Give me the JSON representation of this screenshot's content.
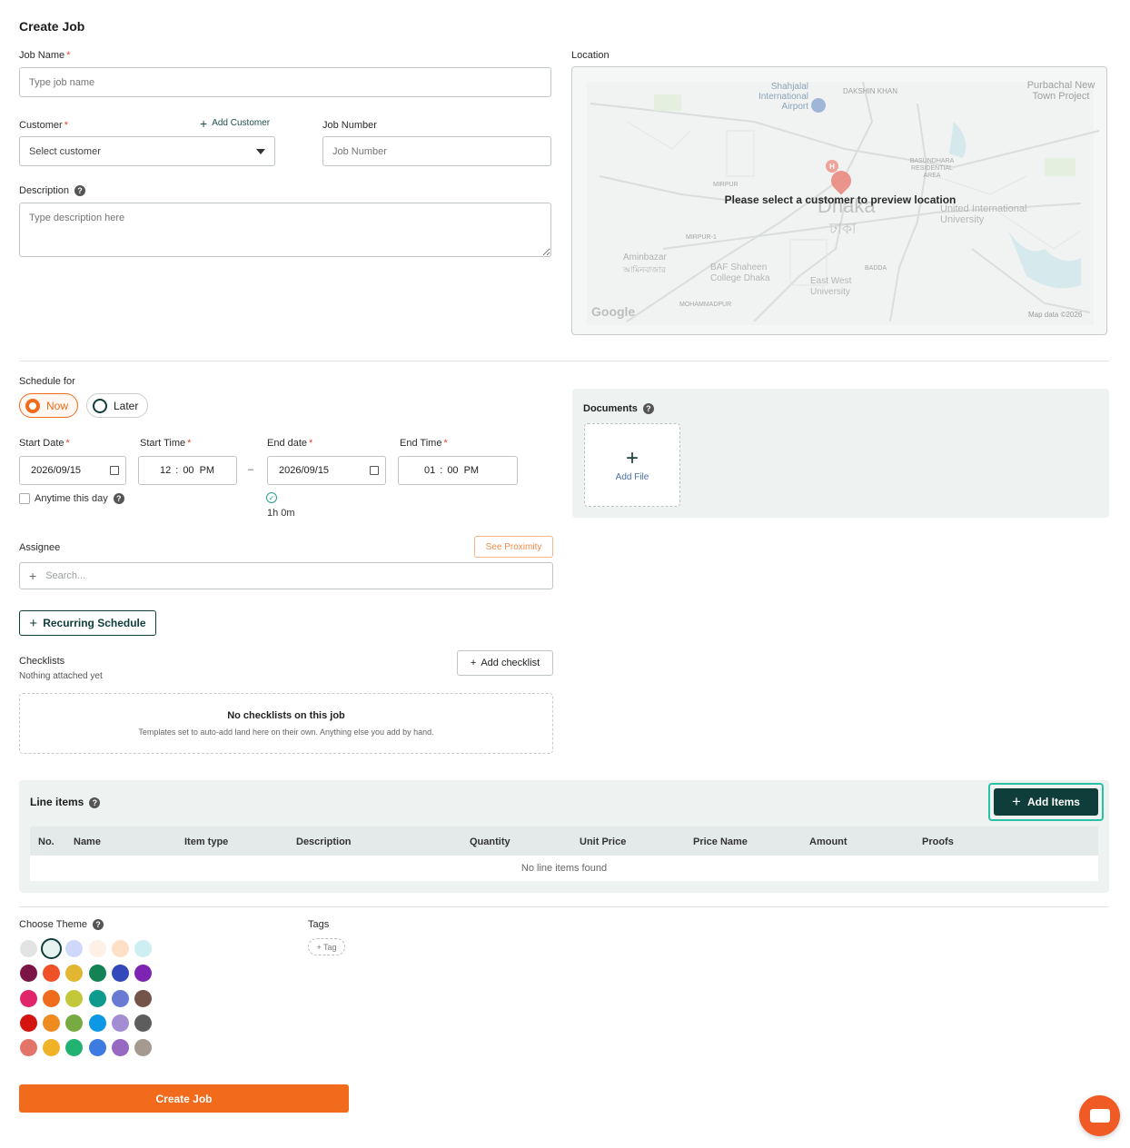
{
  "page_title": "Create Job",
  "job_name": {
    "label": "Job Name",
    "placeholder": "Type job name"
  },
  "customer": {
    "label": "Customer",
    "add_label": "Add Customer",
    "value": "Select customer"
  },
  "job_number": {
    "label": "Job Number",
    "placeholder": "Job Number"
  },
  "description": {
    "label": "Description",
    "placeholder": "Type description here"
  },
  "location": {
    "label": "Location",
    "overlay": "Please select a customer to preview location",
    "map_credit": "Map data ©2026",
    "google": "Google",
    "places": [
      "Shahjalal International Airport",
      "DAKSHIN KHAN",
      "Purbachal New Town Project",
      "BASUNDHARA RESIDENTIAL AREA",
      "MIRPUR",
      "Dhaka",
      "ঢাকা",
      "United International University",
      "MIRPUR-1",
      "Aminbazar",
      "আমিনবাজার",
      "BAF Shaheen College Dhaka",
      "BADDA",
      "East West University",
      "MOHAMMADPUR"
    ]
  },
  "schedule": {
    "label": "Schedule for",
    "now": "Now",
    "later": "Later"
  },
  "start_date": {
    "label": "Start Date",
    "value": "2026/09/15"
  },
  "start_time": {
    "label": "Start Time",
    "hour": "12",
    "minute": "00",
    "ampm": "PM"
  },
  "end_date": {
    "label": "End date",
    "value": "2026/09/15"
  },
  "end_time": {
    "label": "End Time",
    "hour": "01",
    "minute": "00",
    "ampm": "PM"
  },
  "time_sep": ":",
  "range_sep": "–",
  "anytime_label": "Anytime this day",
  "duration": "1h 0m",
  "documents": {
    "label": "Documents",
    "add_file": "Add File"
  },
  "assignee": {
    "label": "Assignee",
    "proximity": "See Proximity",
    "search_placeholder": "Search..."
  },
  "recurring_label": "Recurring Schedule",
  "checklists": {
    "label": "Checklists",
    "sub": "Nothing attached yet",
    "add_label": "Add checklist",
    "empty_title": "No checklists on this job",
    "empty_sub": "Templates set to auto-add land here on their own. Anything else you add by hand."
  },
  "line_items": {
    "title": "Line items",
    "add_label": "Add Items",
    "columns": [
      "No.",
      "Name",
      "Item type",
      "Description",
      "Quantity",
      "Unit Price",
      "Price Name",
      "Amount",
      "Proofs"
    ],
    "empty": "No line items found"
  },
  "theme": {
    "label": "Choose Theme",
    "rows": [
      [
        "#e2e4e4",
        "#e5f2ef",
        "#cfd8fb",
        "#fdf0e6",
        "#fde0c6",
        "#cdeff1"
      ],
      [
        "#7b1545",
        "#ef5128",
        "#e2b630",
        "#138255",
        "#3348bb",
        "#7d25b2"
      ],
      [
        "#e0256a",
        "#ee6c1b",
        "#c3c83b",
        "#0f9a8e",
        "#6a79d2",
        "#745448"
      ],
      [
        "#d3140f",
        "#f08b1f",
        "#77ab42",
        "#0d98e6",
        "#a38ed4",
        "#5d5d5d"
      ],
      [
        "#e47369",
        "#f0b328",
        "#22b372",
        "#3e7be0",
        "#9769c2",
        "#a59a8f"
      ]
    ]
  },
  "tags": {
    "label": "Tags",
    "add_label": "+ Tag"
  },
  "create_label": "Create Job",
  "colors": {
    "accent": "#f26a1b",
    "primary": "#0f3d3a",
    "highlight": "#27c2a6"
  }
}
